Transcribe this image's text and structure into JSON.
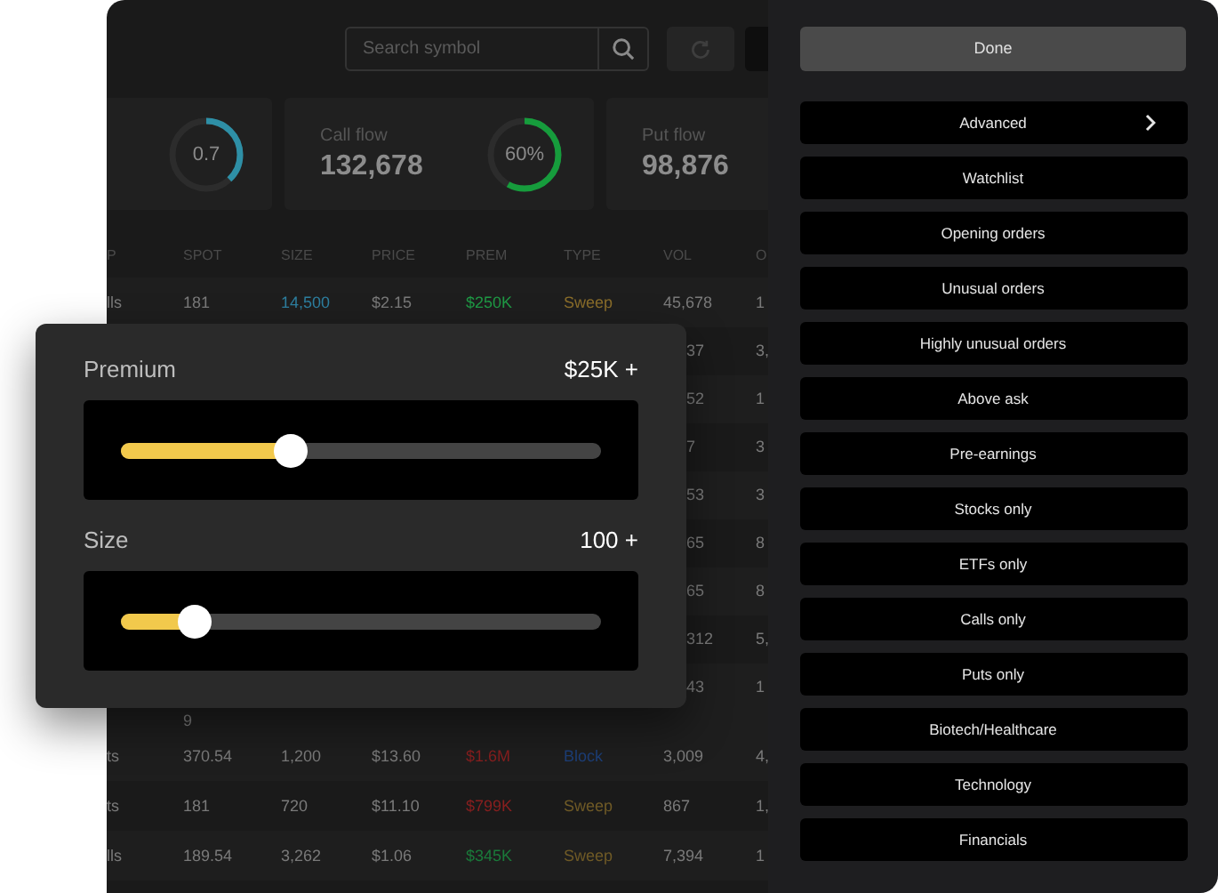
{
  "toolbar": {
    "search": {
      "placeholder": "Search symbol"
    }
  },
  "stats": [
    {
      "gauge": {
        "text": "0.7",
        "level": 0.38,
        "color": "#2e8fa6"
      }
    },
    {
      "label": "Call flow",
      "value": "132,678",
      "gauge": {
        "text": "60%",
        "level": 0.58,
        "color": "#169c3c"
      }
    },
    {
      "label": "Put flow",
      "value": "98,876"
    }
  ],
  "table": {
    "columns": [
      "P",
      "SPOT",
      "SIZE",
      "PRICE",
      "PREM",
      "TYPE",
      "VOL",
      "O"
    ],
    "rows": [
      {
        "kind": "full",
        "cells": [
          {
            "text": "lls"
          },
          {
            "text": "181"
          },
          {
            "text": "14,500",
            "color": "#2d7fa0"
          },
          {
            "text": "$2.15"
          },
          {
            "text": "$250K",
            "color": "#1f9a45"
          },
          {
            "text": "Sweep",
            "color": "#8a6d2a"
          },
          {
            "text": "45,678"
          },
          {
            "text": "1"
          }
        ]
      },
      {
        "kind": "covered",
        "cells": [
          {
            "text": "37"
          },
          {
            "text": "3,"
          }
        ]
      },
      {
        "kind": "covered",
        "cells": [
          {
            "text": "52"
          },
          {
            "text": "1"
          }
        ]
      },
      {
        "kind": "covered",
        "cells": [
          {
            "text": "7"
          },
          {
            "text": "3"
          }
        ]
      },
      {
        "kind": "covered",
        "cells": [
          {
            "text": "53"
          },
          {
            "text": "3"
          }
        ]
      },
      {
        "kind": "covered",
        "cells": [
          {
            "text": "65"
          },
          {
            "text": "8"
          }
        ]
      },
      {
        "kind": "covered",
        "cells": [
          {
            "text": "65"
          },
          {
            "text": "8"
          }
        ]
      },
      {
        "kind": "covered",
        "cells": [
          {
            "text": "312"
          },
          {
            "text": "5,"
          }
        ]
      },
      {
        "kind": "covered",
        "cells": [
          {
            "text": "43"
          },
          {
            "text": "1"
          }
        ]
      },
      {
        "kind": "wrap",
        "cells": [
          {
            "text": "9"
          }
        ]
      },
      {
        "kind": "full",
        "cells": [
          {
            "text": "ts"
          },
          {
            "text": "370.54"
          },
          {
            "text": "1,200"
          },
          {
            "text": "$13.60"
          },
          {
            "text": "$1.6M",
            "color": "#8a1f1f"
          },
          {
            "text": "Block",
            "color": "#1d3f78"
          },
          {
            "text": "3,009"
          },
          {
            "text": "4,"
          }
        ]
      },
      {
        "kind": "full",
        "cells": [
          {
            "text": "ts"
          },
          {
            "text": "181"
          },
          {
            "text": "720"
          },
          {
            "text": "$11.10"
          },
          {
            "text": "$799K",
            "color": "#8a1f1f"
          },
          {
            "text": "Sweep",
            "color": "#6f5a26"
          },
          {
            "text": "867"
          },
          {
            "text": "1,"
          }
        ]
      },
      {
        "kind": "full",
        "cells": [
          {
            "text": "lls"
          },
          {
            "text": "189.54"
          },
          {
            "text": "3,262"
          },
          {
            "text": "$1.06"
          },
          {
            "text": "$345K",
            "color": "#1a7a3a"
          },
          {
            "text": "Sweep",
            "color": "#6f5a26"
          },
          {
            "text": "7,394"
          },
          {
            "text": "1"
          }
        ]
      }
    ]
  },
  "filter_popup": {
    "sliders": [
      {
        "label": "Premium",
        "value": "$25K +",
        "level": 0.35
      },
      {
        "label": "Size",
        "value": "100 +",
        "level": 0.15
      }
    ]
  },
  "filter_panel": {
    "done": "Done",
    "items": [
      {
        "label": "Advanced",
        "has_submenu": true
      },
      {
        "label": "Watchlist",
        "has_submenu": false
      },
      {
        "label": "Opening orders",
        "has_submenu": false
      },
      {
        "label": "Unusual orders",
        "has_submenu": false
      },
      {
        "label": "Highly unusual orders",
        "has_submenu": false
      },
      {
        "label": "Above ask",
        "has_submenu": false
      },
      {
        "label": "Pre-earnings",
        "has_submenu": false
      },
      {
        "label": "Stocks only",
        "has_submenu": false
      },
      {
        "label": "ETFs only",
        "has_submenu": false
      },
      {
        "label": "Calls only",
        "has_submenu": false
      },
      {
        "label": "Puts only",
        "has_submenu": false
      },
      {
        "label": "Biotech/Healthcare",
        "has_submenu": false
      },
      {
        "label": "Technology",
        "has_submenu": false
      },
      {
        "label": "Financials",
        "has_submenu": false
      }
    ]
  }
}
